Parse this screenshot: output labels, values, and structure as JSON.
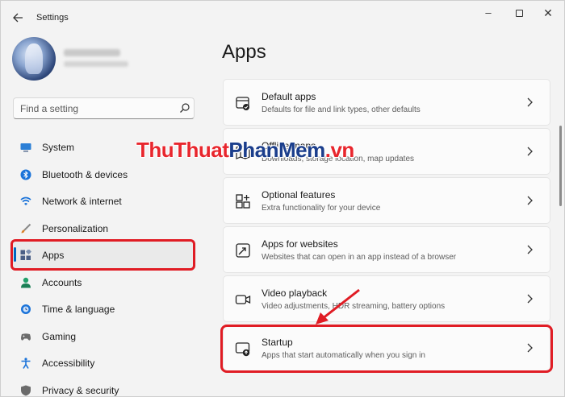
{
  "window": {
    "title": "Settings",
    "back_icon": "back-arrow-icon",
    "minimize_icon": "minimize-icon",
    "maximize_icon": "maximize-icon",
    "close_icon": "close-icon"
  },
  "search": {
    "placeholder": "Find a setting",
    "icon": "search-icon"
  },
  "sidebar": {
    "items": [
      {
        "label": "System",
        "icon": "display-icon",
        "color": "#2b7fd6"
      },
      {
        "label": "Bluetooth & devices",
        "icon": "bluetooth-icon",
        "color": "#1a73d9"
      },
      {
        "label": "Network & internet",
        "icon": "wifi-icon",
        "color": "#1a73d9"
      },
      {
        "label": "Personalization",
        "icon": "brush-icon",
        "color": "#d9822b"
      },
      {
        "label": "Apps",
        "icon": "apps-icon",
        "color": "#4b5f86"
      },
      {
        "label": "Accounts",
        "icon": "account-icon",
        "color": "#22a06b"
      },
      {
        "label": "Time & language",
        "icon": "globe-clock-icon",
        "color": "#1a73d9"
      },
      {
        "label": "Gaming",
        "icon": "gamepad-icon",
        "color": "#6b6b6b"
      },
      {
        "label": "Accessibility",
        "icon": "accessibility-icon",
        "color": "#1a73d9"
      },
      {
        "label": "Privacy & security",
        "icon": "shield-icon",
        "color": "#6b6b6b"
      }
    ],
    "selected": "Apps"
  },
  "main": {
    "title": "Apps",
    "cards": [
      {
        "title": "Default apps",
        "subtitle": "Defaults for file and link types, other defaults",
        "icon": "default-apps-icon"
      },
      {
        "title": "Offline maps",
        "subtitle": "Downloads, storage location, map updates",
        "icon": "map-icon"
      },
      {
        "title": "Optional features",
        "subtitle": "Extra functionality for your device",
        "icon": "optional-features-icon"
      },
      {
        "title": "Apps for websites",
        "subtitle": "Websites that can open in an app instead of a browser",
        "icon": "apps-websites-icon"
      },
      {
        "title": "Video playback",
        "subtitle": "Video adjustments, HDR streaming, battery options",
        "icon": "video-icon"
      },
      {
        "title": "Startup",
        "subtitle": "Apps that start automatically when you sign in",
        "icon": "startup-icon"
      }
    ]
  },
  "watermark": {
    "part1": "ThuThuat",
    "part2": "PhanMem",
    "part3": ".vn"
  },
  "colors": {
    "highlight": "#e01c24",
    "accent": "#0067c0"
  }
}
